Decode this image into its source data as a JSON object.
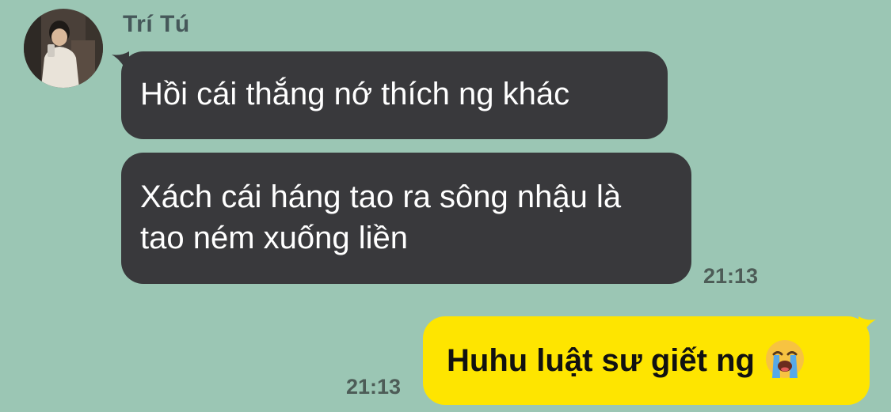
{
  "conversation": {
    "sender_name": "Trí Tú",
    "avatar_icon": "profile-photo-avatar"
  },
  "messages": [
    {
      "direction": "incoming",
      "text": "Hồi cái thắng nớ thích ng khác"
    },
    {
      "direction": "incoming",
      "text": "Xách cái háng tao ra sông nhậu là tao ném xuống liền",
      "time": "21:13"
    },
    {
      "direction": "outgoing",
      "text": "Huhu luật sư giết ng",
      "emoji": "loudly-crying-face",
      "time": "21:13"
    }
  ],
  "colors": {
    "background": "#9bc6b4",
    "incoming_bubble": "#39393c",
    "outgoing_bubble": "#fee500",
    "timestamp": "#4d5c57",
    "name": "#46585a"
  }
}
